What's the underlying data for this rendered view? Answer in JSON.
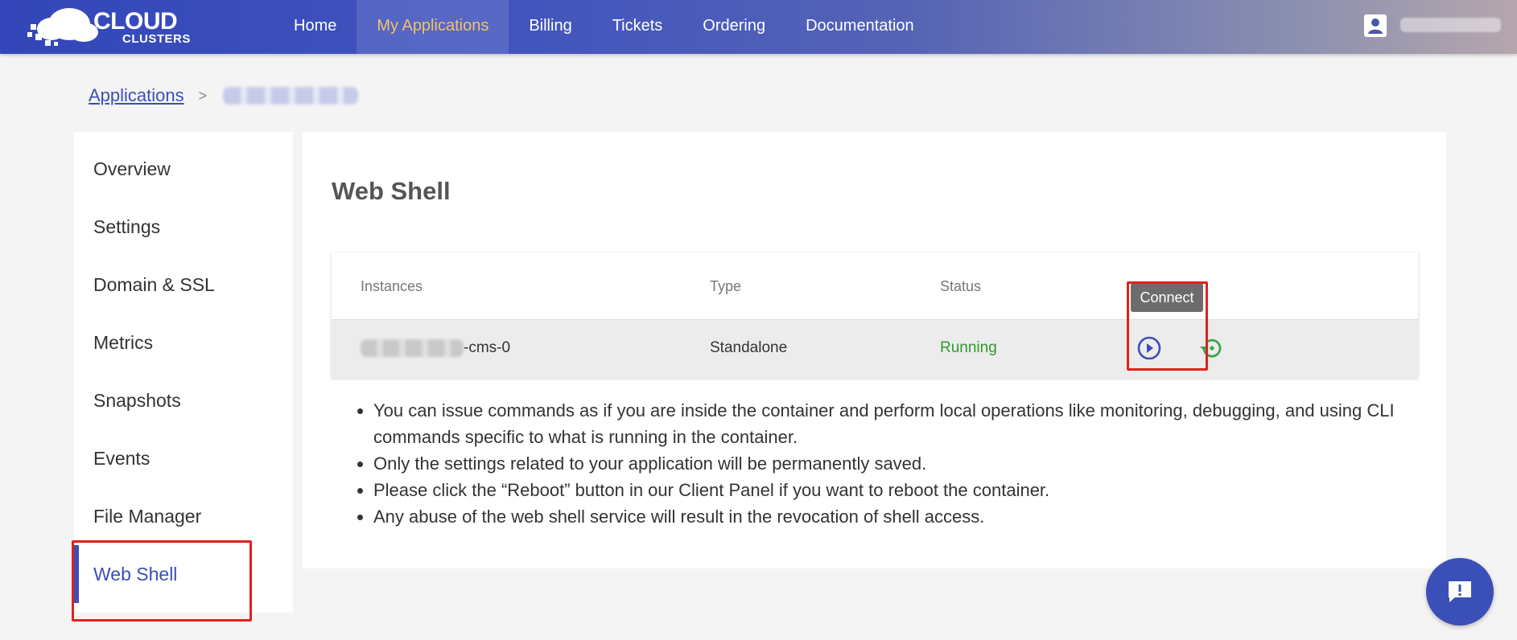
{
  "header": {
    "logo_line1": "CLOUD",
    "logo_line2": "CLUSTERS",
    "nav": [
      {
        "label": "Home"
      },
      {
        "label": "My Applications",
        "active": true
      },
      {
        "label": "Billing"
      },
      {
        "label": "Tickets"
      },
      {
        "label": "Ordering"
      },
      {
        "label": "Documentation"
      }
    ]
  },
  "breadcrumb": {
    "root": "Applications",
    "separator": ">"
  },
  "sidebar": {
    "items": [
      {
        "label": "Overview"
      },
      {
        "label": "Settings"
      },
      {
        "label": "Domain & SSL"
      },
      {
        "label": "Metrics"
      },
      {
        "label": "Snapshots"
      },
      {
        "label": "Events"
      },
      {
        "label": "File Manager"
      },
      {
        "label": "Web Shell",
        "active": true
      }
    ]
  },
  "main": {
    "title": "Web Shell",
    "table": {
      "headers": [
        "Instances",
        "Type",
        "Status"
      ],
      "rows": [
        {
          "instance_suffix": "-cms-0",
          "type": "Standalone",
          "status": "Running"
        }
      ]
    },
    "tooltip": "Connect",
    "notes": [
      "You can issue commands as if you are inside the container and perform local operations like monitoring, debugging, and using CLI commands specific to what is running in the container.",
      "Only the settings related to your application will be permanently saved.",
      "Please click the “Reboot” button in our Client Panel if you want to reboot the container.",
      "Any abuse of the web shell service will result in the revocation of shell access."
    ]
  },
  "colors": {
    "accent": "#3c4fb5",
    "running": "#2e9a2e",
    "highlight_box": "#e3201b"
  },
  "icons": [
    "user-icon",
    "play-circle-icon",
    "restart-icon",
    "chat-alert-icon"
  ]
}
